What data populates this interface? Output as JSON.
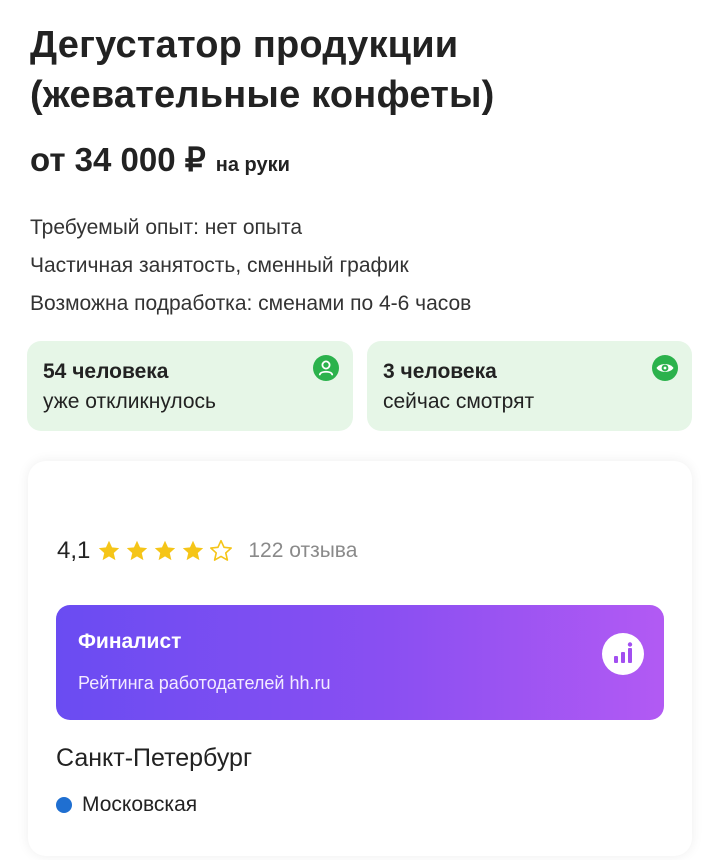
{
  "vacancy": {
    "title": "Дегустатор продукции (жевательные конфеты)",
    "salary_amount": "от 34 000 ₽",
    "salary_note": "на руки"
  },
  "details": [
    "Требуемый опыт: нет опыта",
    "Частичная занятость, сменный график",
    "Возможна подработка: сменами по 4-6 часов"
  ],
  "stats": [
    {
      "count": "54 человека",
      "label": "уже откликнулось",
      "icon": "person-icon"
    },
    {
      "count": "3 человека",
      "label": "сейчас смотрят",
      "icon": "eye-icon"
    }
  ],
  "employer": {
    "rating": "4,1",
    "stars_filled": 4,
    "stars_total": 5,
    "reviews": "122 отзыва",
    "finalist_title": "Финалист",
    "finalist_subtitle": "Рейтинга работодателей hh.ru",
    "city": "Санкт-Петербург",
    "metro": "Московская"
  },
  "colors": {
    "stat_bg": "#e6f6e7",
    "accent_green": "#2bb24c",
    "star": "#f5c518",
    "metro_blue": "#1f6fd1",
    "finalist_gradient_start": "#6a4cf2",
    "finalist_gradient_end": "#b25af3"
  }
}
